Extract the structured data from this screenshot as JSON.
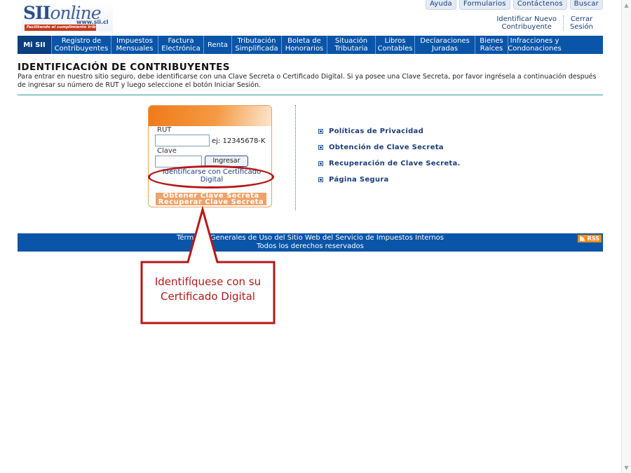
{
  "header": {
    "logo_main": "SII",
    "logo_online": "online",
    "logo_url": "www.sii.cl",
    "logo_slogan": "Facilitando el cumplimiento tributario",
    "top_links": [
      "Ayuda",
      "Formularios",
      "Contáctenos",
      "Buscar"
    ],
    "session_links": {
      "identificar": [
        "Identificar Nuevo",
        "Contribuyente"
      ],
      "cerrar": [
        "Cerrar",
        "Sesión"
      ]
    }
  },
  "nav": [
    {
      "label": "Mi SII",
      "width": 0
    },
    {
      "label": "Registro de Contribuyentes"
    },
    {
      "label": "Impuestos Mensuales"
    },
    {
      "label": "Factura Electrónica"
    },
    {
      "label": "Renta"
    },
    {
      "label": "Tributación Simplificada"
    },
    {
      "label": "Boleta de Honorarios"
    },
    {
      "label": "Situación Tributaria"
    },
    {
      "label": "Libros Contables"
    },
    {
      "label": "Declaraciones Juradas"
    },
    {
      "label": "Bienes Raíces"
    },
    {
      "label": "Infracciones y Condonaciones"
    }
  ],
  "page": {
    "title": "IDENTIFICACIÓN DE CONTRIBUYENTES",
    "intro": "Para entrar en nuestro sitio seguro, debe identificarse con una Clave Secreta o Certificado Digital. Si ya posee una Clave Secreta, por favor ingrésela a continuación después de ingresar su número de RUT y luego seleccione el botón Iniciar Sesión."
  },
  "login": {
    "rut_label": "RUT",
    "rut_value": "",
    "rut_hint": "ej: 12345678-K",
    "clave_label": "Clave",
    "clave_value": "",
    "submit_label": "Ingresar",
    "cert_link": "Identificarse con Certificado Digital",
    "obtain_link": "Obtener Clave Secreta",
    "recover_link": "Recuperar Clave Secreta"
  },
  "side_links": [
    "Políticas de Privacidad",
    "Obtención de Clave Secreta",
    "Recuperación de Clave Secreta.",
    "Página Segura"
  ],
  "footer": {
    "line1": "Términos Generales de Uso del Sitio Web del Servicio de Impuestos Internos",
    "line2": "Todos los derechos reservados",
    "rss": "RSS"
  },
  "annotation": {
    "text": "Identifíquese con su Certificado Digital",
    "color": "#b51818"
  },
  "colors": {
    "nav_blue": "#0a55a8",
    "link_blue": "#1a3d7a",
    "orange": "#f07a18",
    "teal_rule": "#2d9c9a"
  }
}
